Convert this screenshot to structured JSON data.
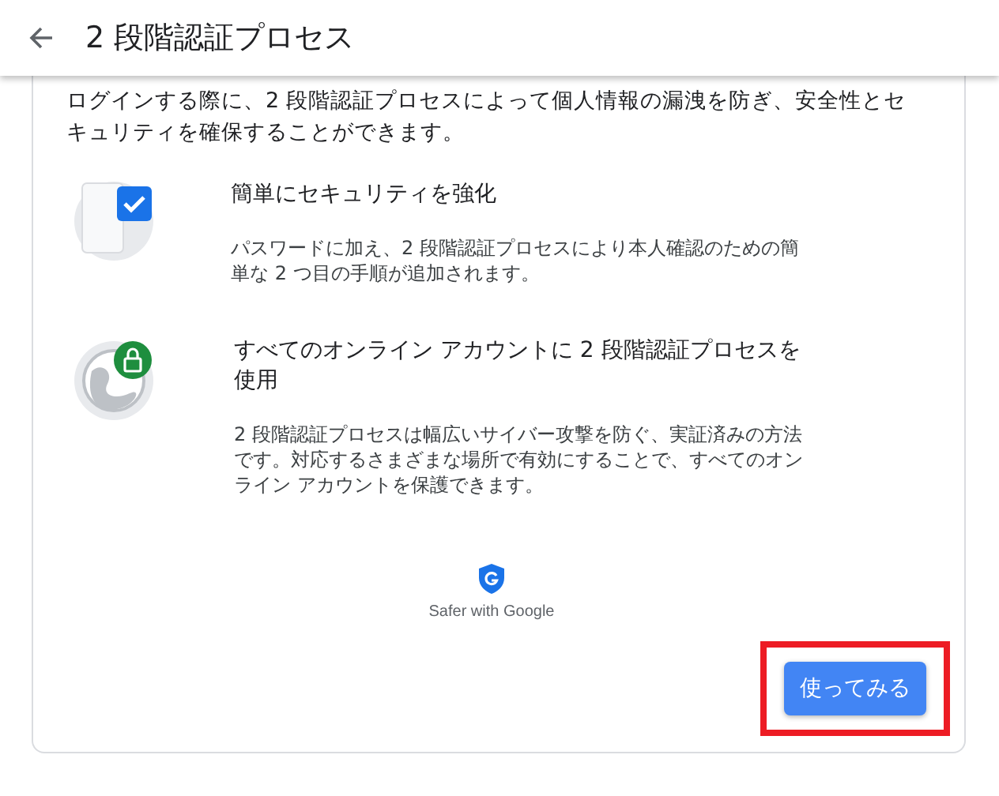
{
  "header": {
    "title": "2 段階認証プロセス"
  },
  "intro": "ログインする際に、2 段階認証プロセスによって個人情報の漏洩を防ぎ、安全性とセキュリティを確保することができます。",
  "features": [
    {
      "kind": "phone",
      "title": "簡単にセキュリティを強化",
      "description": "パスワードに加え、2 段階認証プロセスにより本人確認のための簡単な 2 つ目の手順が追加されます。"
    },
    {
      "kind": "globe",
      "title": "すべてのオンライン アカウントに 2 段階認証プロセスを使用",
      "description": "2 段階認証プロセスは幅広いサイバー攻撃を防ぐ、実証済みの方法です。対応するさまざまな場所で有効にすることで、すべてのオンライン アカウントを保護できます。"
    }
  ],
  "badge": {
    "caption": "Safer with Google"
  },
  "button": {
    "label": "使ってみる",
    "highlighted": true
  }
}
